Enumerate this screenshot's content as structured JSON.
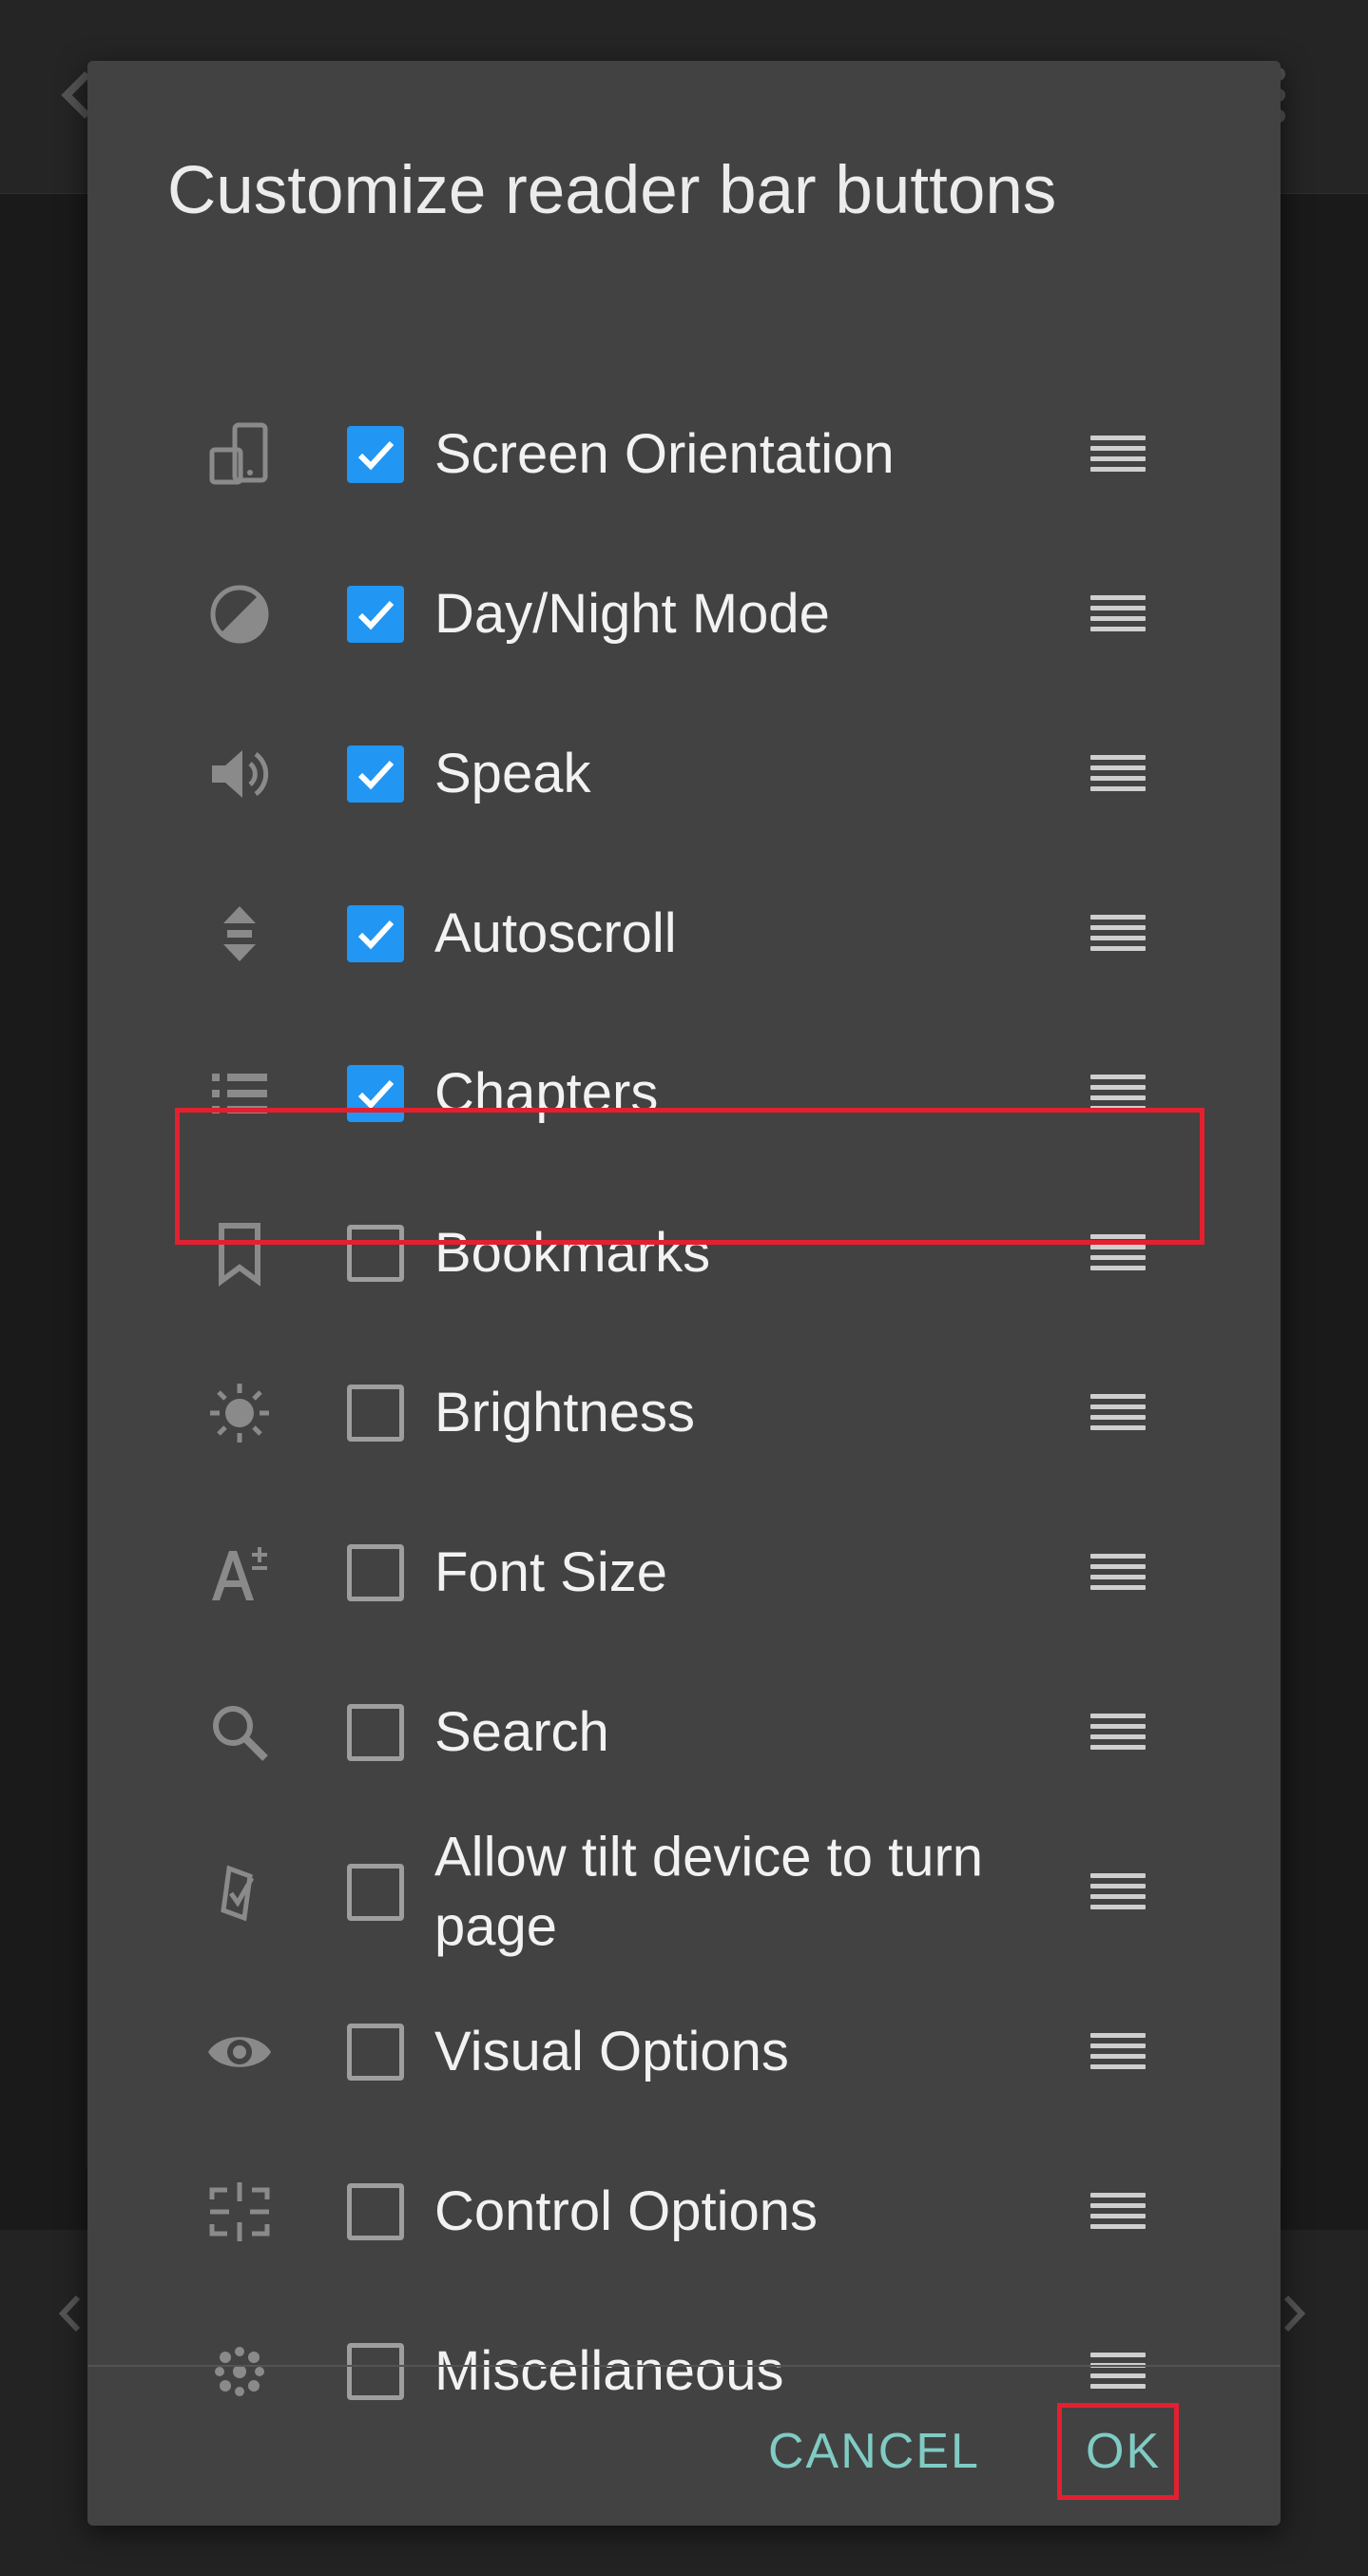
{
  "background": {
    "back_icon": "arrow-left-icon",
    "menu_icon": "more-vertical-icon",
    "prev_icon": "chevron-left-icon",
    "next_icon": "chevron-right-icon"
  },
  "dialog": {
    "title": "Customize reader bar buttons",
    "items": [
      {
        "label": "Screen Orientation",
        "checked": true,
        "icon": "screen-rotation-icon"
      },
      {
        "label": "Day/Night Mode",
        "checked": true,
        "icon": "contrast-icon"
      },
      {
        "label": "Speak",
        "checked": true,
        "icon": "volume-icon"
      },
      {
        "label": "Autoscroll",
        "checked": true,
        "icon": "autoscroll-icon"
      },
      {
        "label": "Chapters",
        "checked": true,
        "icon": "list-icon"
      },
      {
        "label": "Bookmarks",
        "checked": false,
        "icon": "bookmark-icon"
      },
      {
        "label": "Brightness",
        "checked": false,
        "icon": "brightness-icon"
      },
      {
        "label": "Font Size",
        "checked": false,
        "icon": "font-size-icon"
      },
      {
        "label": "Search",
        "checked": false,
        "icon": "search-icon"
      },
      {
        "label": "Allow tilt device to turn page",
        "checked": false,
        "icon": "tilt-icon"
      },
      {
        "label": "Visual Options",
        "checked": false,
        "icon": "eye-icon"
      },
      {
        "label": "Control Options",
        "checked": false,
        "icon": "control-options-icon"
      },
      {
        "label": "Miscellaneous",
        "checked": false,
        "icon": "miscellaneous-icon"
      }
    ],
    "cancel_label": "CANCEL",
    "ok_label": "OK"
  },
  "colors": {
    "dialog_bg": "#424242",
    "checkbox_checked": "#2196f3",
    "button_text": "#80cbc4",
    "highlight_border": "#e3202f"
  }
}
